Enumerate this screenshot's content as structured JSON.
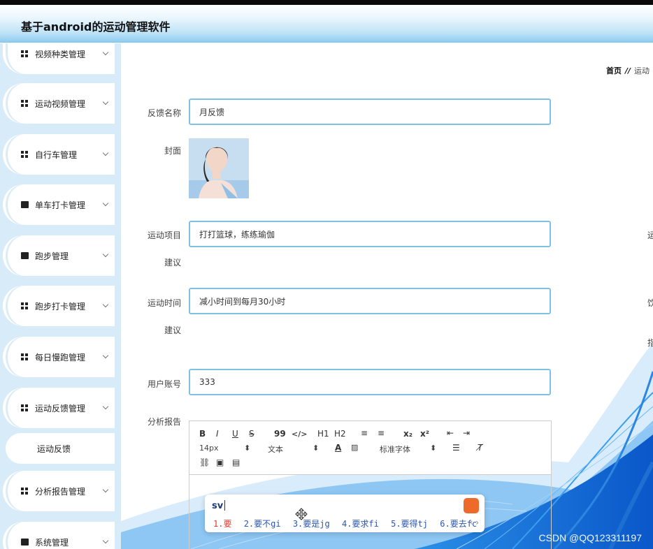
{
  "app": {
    "title": "基于android的运动管理软件"
  },
  "sidebar": {
    "items": [
      {
        "label": "视频种类管理"
      },
      {
        "label": "运动视频管理"
      },
      {
        "label": "自行车管理"
      },
      {
        "label": "单车打卡管理"
      },
      {
        "label": "跑步管理"
      },
      {
        "label": "跑步打卡管理"
      },
      {
        "label": "每日慢跑管理"
      },
      {
        "label": "运动反馈管理"
      },
      {
        "label": "分析报告管理"
      },
      {
        "label": "系统管理"
      }
    ],
    "sub_item": "运动反馈"
  },
  "breadcrumb": {
    "home": "首页",
    "sep": "//",
    "current": "运动"
  },
  "form": {
    "feedback_name": {
      "label": "反馈名称",
      "value": "月反馈"
    },
    "cover": {
      "label": "封面"
    },
    "sport_project": {
      "label": "运动项目",
      "label2": "建议",
      "value": "打打篮球，练练瑜伽"
    },
    "sport_time": {
      "label": "运动时间",
      "label2": "建议",
      "value": "减小时间到每月30小时"
    },
    "user_account": {
      "label": "用户账号",
      "value": "333"
    },
    "analysis_report": {
      "label": "分析报告"
    }
  },
  "right_cut": {
    "a": "运",
    "b": "饮",
    "c": "指"
  },
  "editor": {
    "row1": [
      "B",
      "I",
      "U",
      "S",
      "99",
      "</>",
      "H1",
      "H2",
      "≡",
      "≡",
      "x₂",
      "x²",
      "⇤",
      "⇥"
    ],
    "font_size": "14px",
    "text_type": "文本",
    "font_family": "标准字体"
  },
  "ime": {
    "composition": "sv",
    "candidates": [
      "1.要",
      "2.要不gi",
      "3.要是jg",
      "4.要求fi",
      "5.要得tj",
      "6.要去fc"
    ]
  },
  "watermark": "CSDN @QQ123311197"
}
